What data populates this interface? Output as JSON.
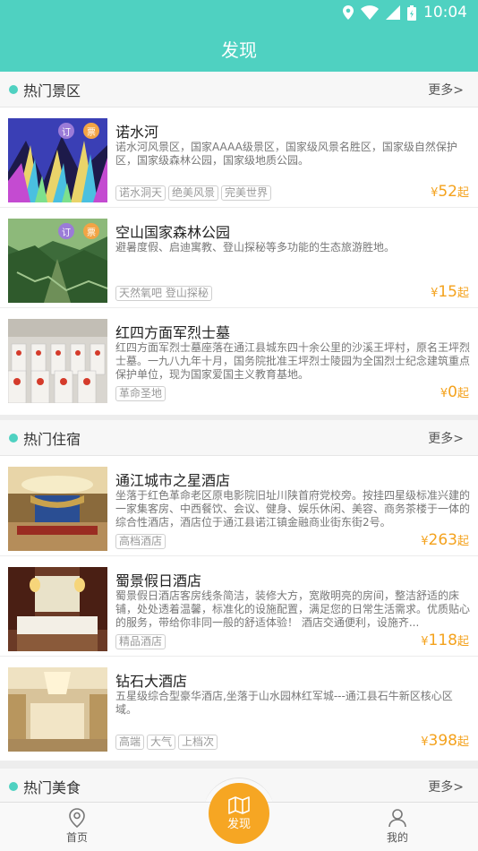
{
  "status": {
    "time": "10:04"
  },
  "appbar": {
    "title": "发现"
  },
  "sections": [
    {
      "title": "热门景区",
      "more": "更多>",
      "items": [
        {
          "title": "诺水河",
          "desc": "诺水河风景区，国家AAAA级景区，国家级风景名胜区，国家级自然保护区，国家级森林公园，国家级地质公园。",
          "tags": [
            "诺水洞天",
            "绝美风景",
            "完美世界"
          ],
          "price_prefix": "¥",
          "price": "52",
          "price_suffix": "起",
          "badges": [
            "订",
            "票"
          ]
        },
        {
          "title": "空山国家森林公园",
          "desc": "避暑度假、启迪寓教、登山探秘等多功能的生态旅游胜地。",
          "tags": [
            "天然氧吧 登山探秘"
          ],
          "price_prefix": "¥",
          "price": "15",
          "price_suffix": "起",
          "badges": [
            "订",
            "票"
          ]
        },
        {
          "title": "红四方面军烈士墓",
          "desc": "红四方面军烈士墓座落在通江县城东四十余公里的沙溪王坪村，原名王坪烈士墓。一九八九年十月，国务院批准王坪烈士陵园为全国烈士纪念建筑重点保护单位，现为国家爱国主义教育基地。",
          "tags": [
            "革命圣地"
          ],
          "price_prefix": "¥",
          "price": "0",
          "price_suffix": "起",
          "badges": []
        }
      ]
    },
    {
      "title": "热门住宿",
      "more": "更多>",
      "items": [
        {
          "title": "通江城市之星酒店",
          "desc": "坐落于红色革命老区原电影院旧址川陕首府党校旁。按挂四星级标准兴建的一家集客房、中西餐饮、会议、健身、娱乐休闲、美容、商务茶楼于一体的综合性酒店，酒店位于通江县诺江镇金融商业街东街2号。",
          "tags": [
            "高档酒店"
          ],
          "price_prefix": "¥",
          "price": "263",
          "price_suffix": "起",
          "badges": []
        },
        {
          "title": "蜀景假日酒店",
          "desc": "蜀景假日酒店客房线条简洁，装修大方，宽敞明亮的房间，整洁舒适的床铺，处处透着温馨，标准化的设施配置，满足您的日常生活需求。优质贴心的服务，带给你非同一般的舒适体验！ 酒店交通便利，设施齐...",
          "tags": [
            "精品酒店"
          ],
          "price_prefix": "¥",
          "price": "118",
          "price_suffix": "起",
          "badges": []
        },
        {
          "title": "钻石大酒店",
          "desc": "五星级综合型豪华酒店,坐落于山水园林红军城---通江县石牛新区核心区域。",
          "tags": [
            "高端",
            "大气",
            "上档次"
          ],
          "price_prefix": "¥",
          "price": "398",
          "price_suffix": "起",
          "badges": []
        }
      ]
    },
    {
      "title": "热门美食",
      "more": "更多>",
      "items": []
    }
  ],
  "tabbar": {
    "home": "首页",
    "discover": "发现",
    "mine": "我的"
  },
  "colors": {
    "accent": "#4fd1c1",
    "price": "#f4a21d",
    "fab": "#f6a623",
    "badge_purple": "#9b7bd8",
    "badge_orange": "#f3a445"
  }
}
